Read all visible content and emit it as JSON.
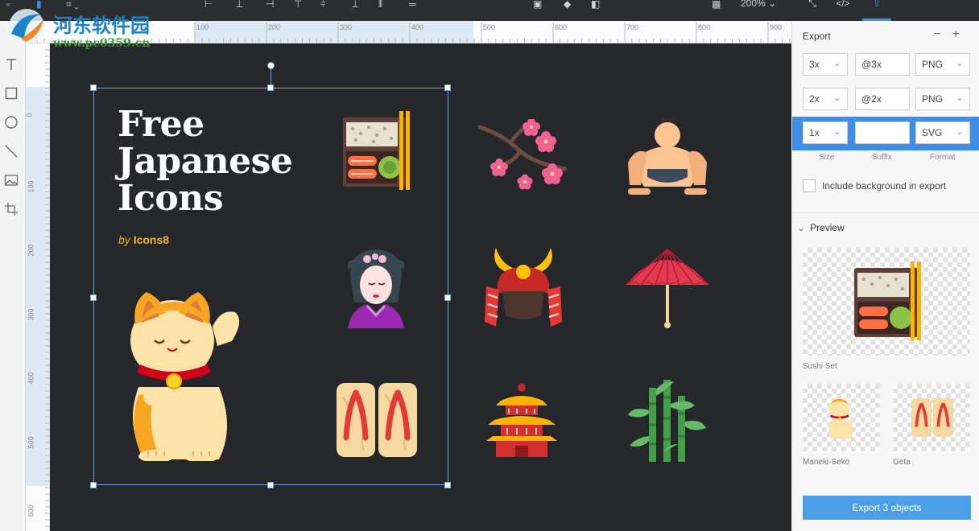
{
  "toolbar": {
    "zoom_label": "200%"
  },
  "rulers": {
    "horizontal": [
      "100",
      "200",
      "300",
      "400",
      "500",
      "600",
      "700",
      "800",
      "900"
    ],
    "vertical": [
      "0",
      "100",
      "200",
      "300",
      "400",
      "500",
      "600"
    ]
  },
  "artboard": {
    "title_lines": [
      "Free",
      "Japanese",
      "Icons"
    ],
    "by": "by",
    "brand": "Icons8"
  },
  "export": {
    "title": "Export",
    "rows": [
      {
        "size": "3x",
        "suffix": "@3x",
        "format": "PNG"
      },
      {
        "size": "2x",
        "suffix": "@2x",
        "format": "PNG"
      },
      {
        "size": "1x",
        "suffix": "",
        "format": "SVG"
      }
    ],
    "col_labels": {
      "size": "Size",
      "suffix": "Suffix",
      "format": "Format"
    },
    "include_bg": "Include background in export",
    "preview_title": "Preview",
    "previews": [
      {
        "name": "Sushi Set"
      },
      {
        "name": "Maneki-Seko"
      },
      {
        "name": "Geta"
      }
    ],
    "button": "Export 3 objects"
  },
  "watermark": {
    "name": "河东软件园",
    "url": "www.pc0359.cn"
  }
}
